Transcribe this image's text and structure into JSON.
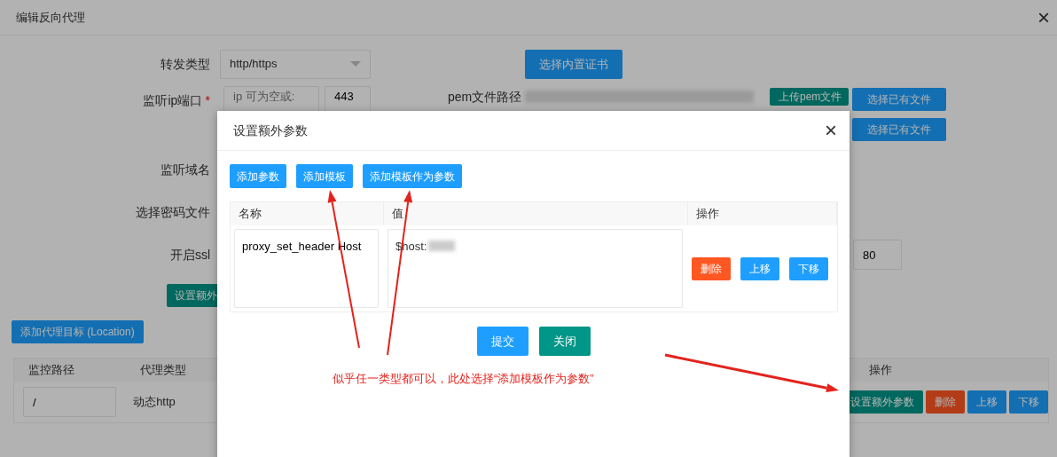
{
  "dialog": {
    "title": "编辑反向代理",
    "close_icon": "×"
  },
  "form": {
    "forward_type": {
      "label": "转发类型",
      "value": "http/https"
    },
    "builtin_cert_button": "选择内置证书",
    "listen": {
      "label": "监听ip端口",
      "required_mark": "*",
      "ip_placeholder": "ip 可为空或:",
      "port": "443"
    },
    "pem": {
      "label": "pem文件路径",
      "upload_button": "上传pem文件",
      "choose_buttons": [
        "选择已有文件",
        "选择已有文件"
      ]
    },
    "domain_label": "监听域名",
    "password_label": "选择密码文件",
    "ssl": {
      "label": "开启ssl",
      "port": "80"
    },
    "extra_params_button": "设置额外"
  },
  "add_location_button": "添加代理目标 (Location)",
  "locations": {
    "columns": [
      "监控路径",
      "代理类型",
      "操作"
    ],
    "rows": [
      {
        "path": "/",
        "type": "动态http",
        "actions": [
          {
            "kind": "settings",
            "label": "设置额外参数"
          },
          {
            "kind": "delete",
            "label": "删除"
          },
          {
            "kind": "move",
            "label": "上移"
          },
          {
            "kind": "move",
            "label": "下移"
          }
        ]
      }
    ]
  },
  "modal": {
    "title": "设置额外参数",
    "close_icon": "×",
    "toolbar": [
      "添加参数",
      "添加模板",
      "添加模板作为参数"
    ],
    "columns": [
      "名称",
      "值",
      "操作"
    ],
    "rows": [
      {
        "name": "proxy_set_header Host",
        "value": "$host:",
        "actions": [
          {
            "kind": "delete",
            "label": "删除"
          },
          {
            "kind": "move",
            "label": "上移"
          },
          {
            "kind": "move",
            "label": "下移"
          }
        ]
      }
    ],
    "footer": [
      {
        "kind": "submit",
        "label": "提交"
      },
      {
        "kind": "close",
        "label": "关闭"
      }
    ]
  },
  "annotation": {
    "text": "似乎任一类型都可以，此处选择“添加模板作为参数”"
  }
}
